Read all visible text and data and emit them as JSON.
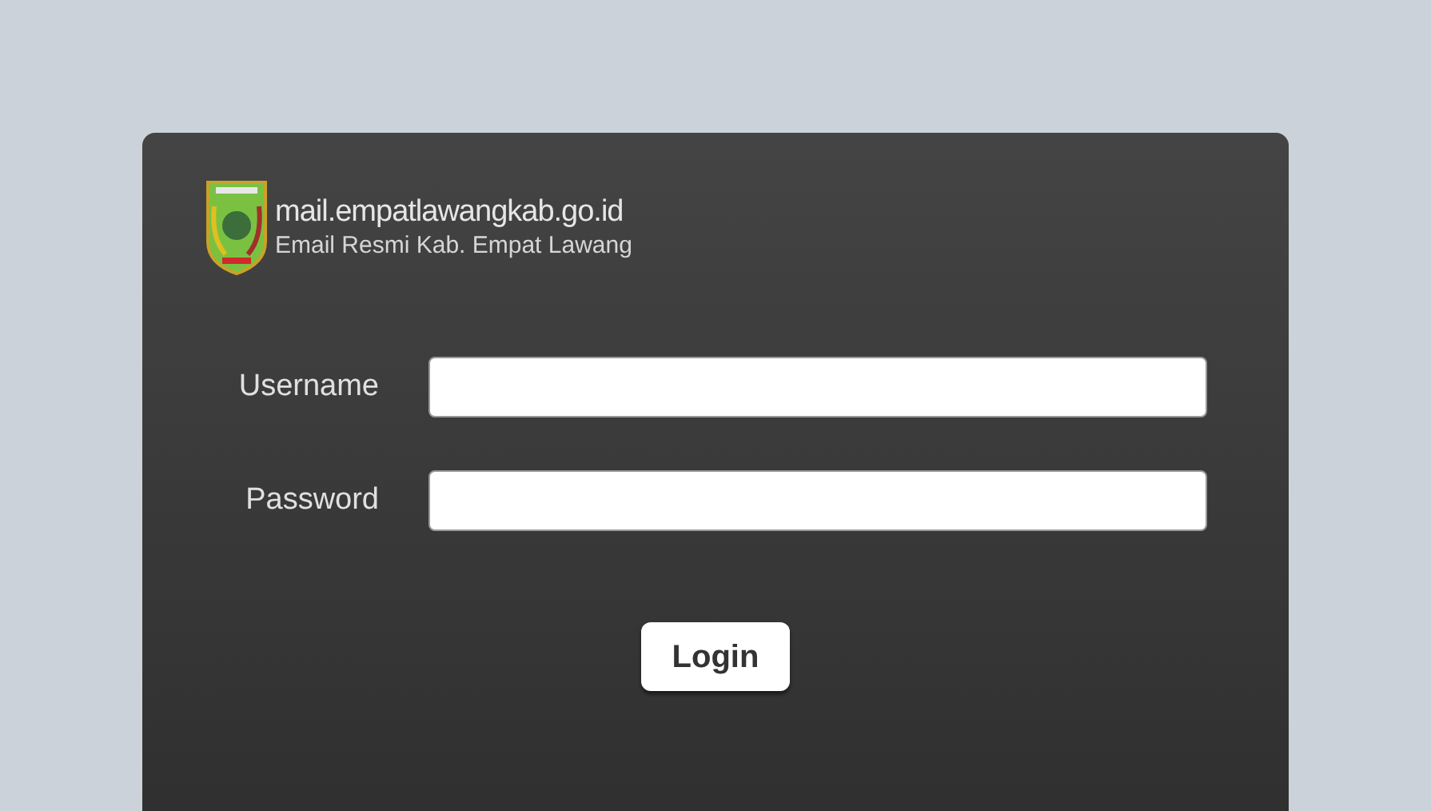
{
  "logo": {
    "title": "mail.empatlawangkab.go.id",
    "subtitle": "Email Resmi Kab. Empat Lawang"
  },
  "fields": [
    {
      "label": "Username"
    },
    {
      "label": "Password"
    }
  ],
  "button": "Login"
}
